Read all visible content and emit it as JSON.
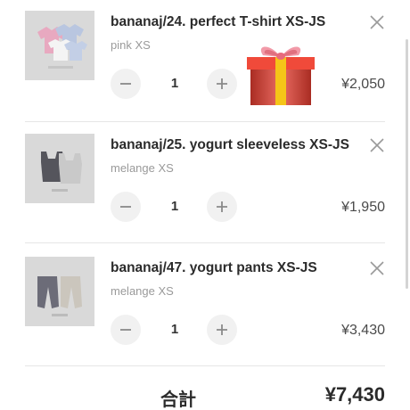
{
  "cart": {
    "items": [
      {
        "name": "bananaj/24. perfect T-shirt XS-JS",
        "variant": "pink XS",
        "quantity": "1",
        "price": "¥2,050",
        "thumbnail_icon": "tshirts-product-photo"
      },
      {
        "name": "bananaj/25. yogurt sleeveless XS-JS",
        "variant": "melange XS",
        "quantity": "1",
        "price": "¥1,950",
        "thumbnail_icon": "sleeveless-product-photo"
      },
      {
        "name": "bananaj/47. yogurt pants XS-JS",
        "variant": "melange XS",
        "quantity": "1",
        "price": "¥3,430",
        "thumbnail_icon": "pants-product-photo"
      }
    ],
    "gift_icon": "wrapped-gift-emoji",
    "total_label": "合計",
    "total_value": "¥7,430",
    "colors": {
      "text": "#2b2b2b",
      "muted": "#9a9a9a",
      "stepper_bg": "#f1f1f1",
      "divider": "#e6e6e6",
      "gift_red": "#e23b2e",
      "gift_ribbon": "#f5c518"
    }
  }
}
